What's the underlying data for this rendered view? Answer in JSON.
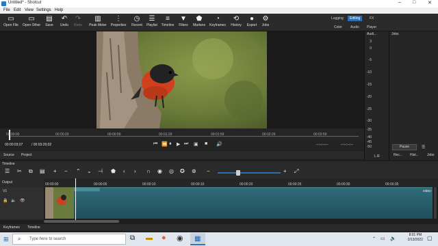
{
  "window": {
    "title": "Untitled* - Shotcut"
  },
  "menu": [
    "File",
    "Edit",
    "View",
    "Settings",
    "Help"
  ],
  "toolbar": [
    {
      "label": "Open File",
      "icon": "open-file-icon"
    },
    {
      "label": "Open Other",
      "icon": "open-other-icon"
    },
    {
      "label": "Save",
      "icon": "save-icon"
    },
    {
      "label": "Undo",
      "icon": "undo-icon"
    },
    {
      "label": "Redo",
      "icon": "redo-icon"
    },
    {
      "label": "Peak Meter",
      "icon": "peak-meter-icon"
    },
    {
      "label": "Properties",
      "icon": "properties-icon"
    },
    {
      "label": "Recent",
      "icon": "recent-icon"
    },
    {
      "label": "Playlist",
      "icon": "playlist-icon"
    },
    {
      "label": "Timeline",
      "icon": "timeline-icon"
    },
    {
      "label": "Filters",
      "icon": "filters-icon"
    },
    {
      "label": "Markers",
      "icon": "markers-icon"
    },
    {
      "label": "Keyframes",
      "icon": "keyframes-icon"
    },
    {
      "label": "History",
      "icon": "history-icon"
    },
    {
      "label": "Export",
      "icon": "export-icon"
    },
    {
      "label": "Jobs",
      "icon": "jobs-icon"
    }
  ],
  "modes": {
    "top": [
      "Logging",
      "Editing",
      "FX"
    ],
    "bottom": [
      "Color",
      "Audio",
      "Player"
    ],
    "active": "Editing"
  },
  "scrubber_ticks": [
    "00:00:00",
    "00:00:29",
    "00:00:59",
    "00:01:29",
    "00:01:59",
    "00:02:29",
    "00:02:59"
  ],
  "transport": {
    "position": "00:00:03;07",
    "duration": "/ 00:03:26;02",
    "in_point": "--:--:--:--",
    "out_point": "--:--:--:--"
  },
  "source_tabs": [
    "Source",
    "Project"
  ],
  "audio_panel": {
    "title": "Audi...",
    "db_labels": [
      "3",
      "0",
      "-5",
      "-10",
      "-15",
      "-20",
      "-25",
      "-30",
      "-35",
      "-40",
      "-45",
      "-50"
    ],
    "channels": "L  R"
  },
  "jobs_panel": {
    "title": "Jobs",
    "pause": "Pause",
    "tabs": [
      "Rec...",
      "Hist...",
      "Jobs"
    ]
  },
  "timeline": {
    "title": "Timeline",
    "output_label": "Output",
    "track_name": "V1",
    "ruler": [
      "00:00:00",
      "00:00:05",
      "00:00:10",
      "00:00:15",
      "00:00:20",
      "00:00:25",
      "00:00:30",
      "00:00:35"
    ],
    "clip_label": "video"
  },
  "bottom_tabs": [
    "Keyframes",
    "Timeline"
  ],
  "taskbar": {
    "search_placeholder": "Type here to search",
    "time": "8:01 PM",
    "date": "2/13/2022"
  }
}
